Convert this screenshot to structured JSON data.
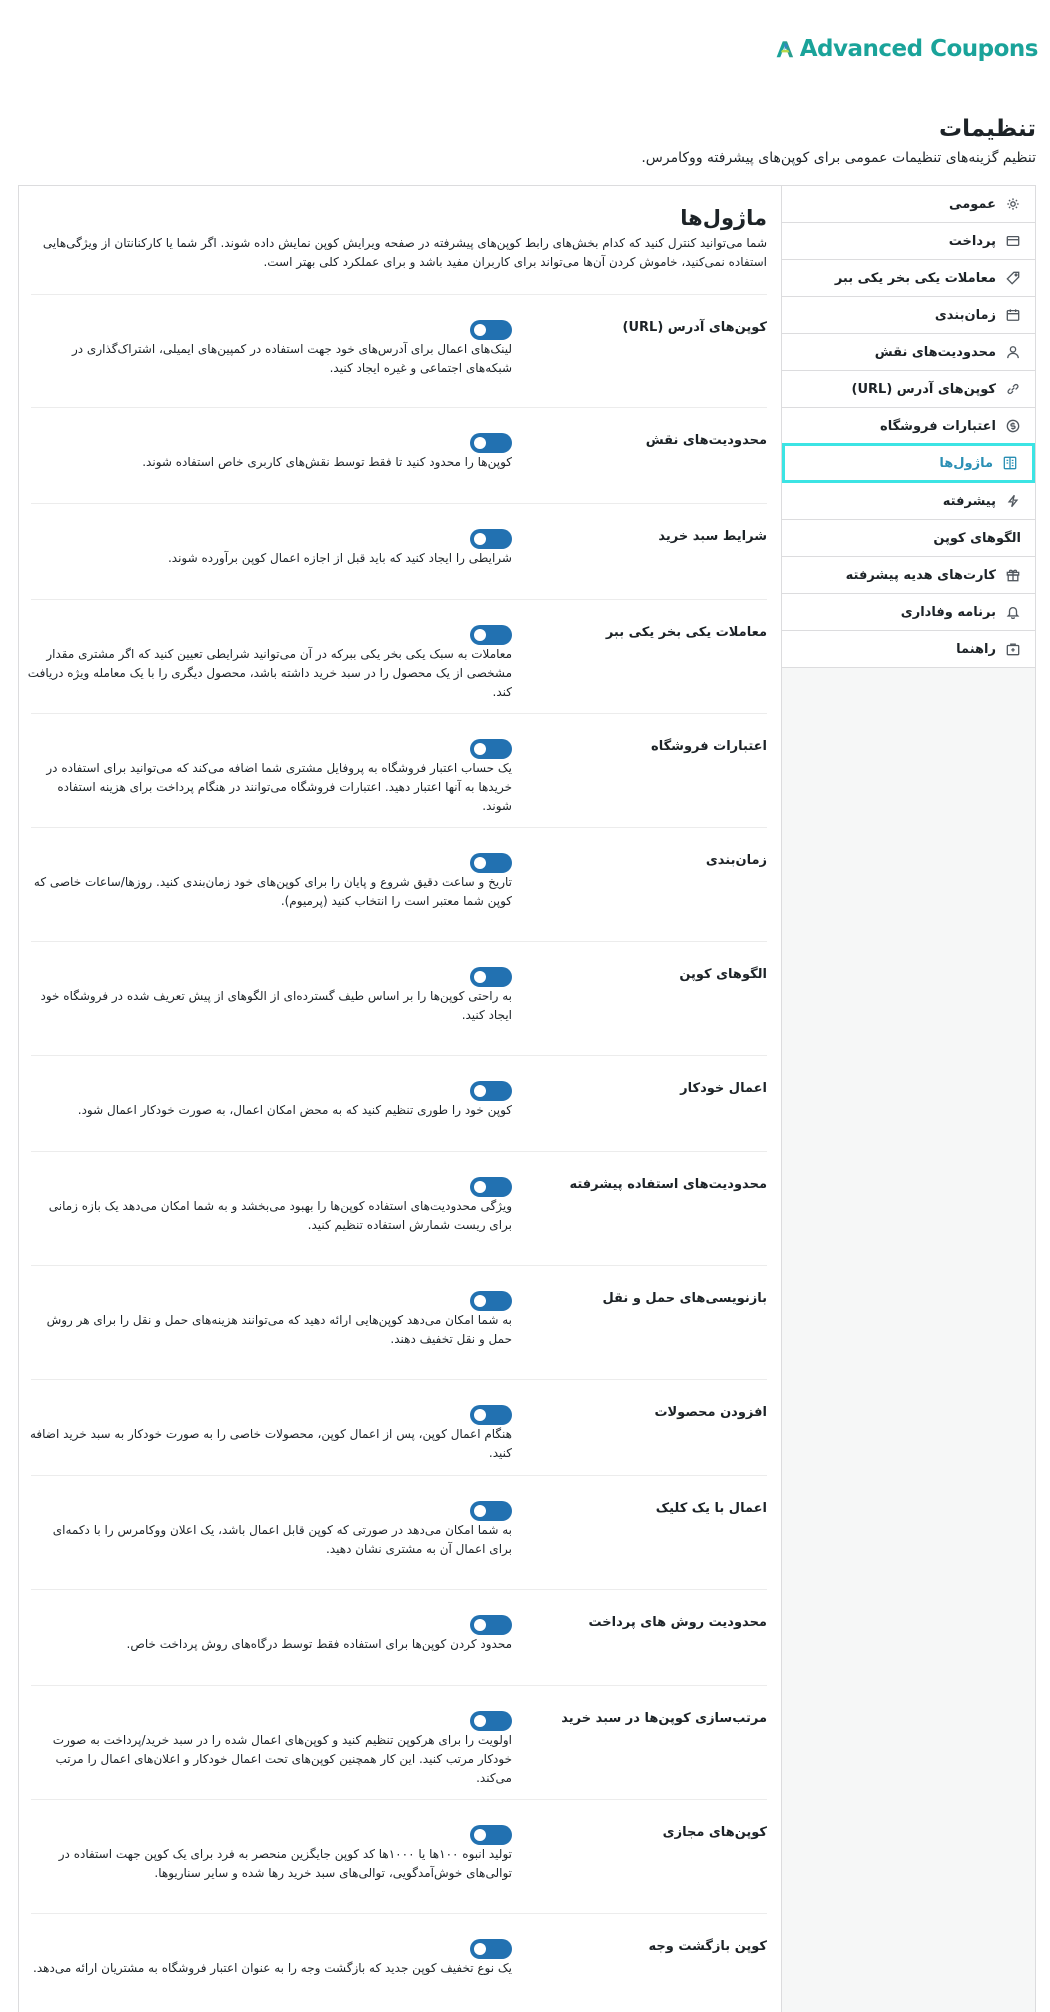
{
  "brand": {
    "name": "Advanced Coupons",
    "color": "#1aa39a"
  },
  "page": {
    "title": "تنظیمات",
    "description": "تنظیم گزینه‌های تنظیمات عمومی برای کوپن‌های پیشرفته ووکامرس."
  },
  "sidebar": {
    "items": [
      {
        "label": "عمومی",
        "icon": "gear-icon"
      },
      {
        "label": "پرداخت",
        "icon": "card-icon"
      },
      {
        "label": "معاملات یکی بخر یکی ببر",
        "icon": "tag-icon"
      },
      {
        "label": "زمان‌بندی",
        "icon": "calendar-icon"
      },
      {
        "label": "محدودیت‌های نقش",
        "icon": "user-icon"
      },
      {
        "label": "کوپن‌های آدرس (URL)",
        "icon": "link-icon"
      },
      {
        "label": "اعتبارات فروشگاه",
        "icon": "dollar-icon"
      },
      {
        "label": "ماژول‌ها",
        "icon": "modules-icon",
        "active": true
      },
      {
        "label": "پیشرفته",
        "icon": "bolt-icon"
      },
      {
        "label": "الگوهای کوپن",
        "icon": ""
      },
      {
        "label": "کارت‌های هدیه پیشرفته",
        "icon": "gift-icon"
      },
      {
        "label": "برنامه وفاداری",
        "icon": "bell-icon"
      },
      {
        "label": "راهنما",
        "icon": "help-icon"
      }
    ],
    "active_color": "#3ce4e4"
  },
  "modules": {
    "title": "ماژول‌ها",
    "description": "شما می‌توانید کنترل کنید که کدام بخش‌های رابط کوپن‌های پیشرفته در صفحه ویرایش کوپن نمایش داده شوند. اگر شما یا کارکنانتان از ویژگی‌هایی استفاده نمی‌کنید، خاموش کردن آن‌ها می‌تواند برای کاربران مفید باشد و برای عملکرد کلی بهتر است.",
    "toggle_color": "#2271b1",
    "rows": [
      {
        "label": "کوپن‌های آدرس (URL)",
        "text": "لینک‌های اعمال برای آدرس‌های خود جهت استفاده در کمپین‌های ایمیلی، اشتراک‌گذاری در شبکه‌های اجتماعی و غیره ایجاد کنید."
      },
      {
        "label": "محدودیت‌های نقش",
        "text": "کوپن‌ها را محدود کنید تا فقط توسط نقش‌های کاربری خاص استفاده شوند."
      },
      {
        "label": "شرایط سبد خرید",
        "text": "شرایطی را ایجاد کنید که باید قبل از اجازه اعمال کوپن برآورده شوند."
      },
      {
        "label": "معاملات یکی بخر یکی ببر",
        "text": "معاملات به سبک یکی بخر یکی ببرکه در آن می‌توانید شرایطی تعیین کنید که اگر مشتری مقدار مشخصی از یک محصول را در سبد خرید داشته باشد، محصول دیگری را با یک معامله ویژه دریافت کند."
      },
      {
        "label": "اعتبارات فروشگاه",
        "text": "یک حساب اعتبار فروشگاه به پروفایل مشتری شما اضافه می‌کند که می‌توانید برای استفاده در خریدها به آنها اعتبار دهید. اعتبارات فروشگاه می‌توانند در هنگام پرداخت برای هزینه استفاده شوند."
      },
      {
        "label": "زمان‌بندی",
        "text": "تاریخ و ساعت دقیق شروع و پایان را برای کوپن‌های خود زمان‌بندی کنید. روزها/ساعات خاصی که کوپن شما معتبر است را انتخاب کنید (پرمیوم)."
      },
      {
        "label": "الگوهای کوپن",
        "text": "به راحتی کوپن‌ها را بر اساس طیف گسترده‌ای از الگوهای از پیش تعریف شده در فروشگاه خود ایجاد کنید."
      },
      {
        "label": "اعمال خودکار",
        "text": "کوپن خود را طوری تنظیم کنید که به محض امکان اعمال، به صورت خودکار اعمال شود."
      },
      {
        "label": "محدودیت‌های استفاده پیشرفته",
        "text": "ویژگی محدودیت‌های استفاده کوپن‌ها را بهبود می‌بخشد و به شما امکان می‌دهد یک بازه زمانی برای ریست شمارش استفاده تنظیم کنید."
      },
      {
        "label": "بازنویسی‌های حمل و نقل",
        "text": "به شما امکان می‌دهد کوپن‌هایی ارائه دهید که می‌توانند هزینه‌های حمل و نقل را برای هر روش حمل و نقل تخفیف دهند."
      },
      {
        "label": "افزودن محصولات",
        "text": "هنگام اعمال کوپن، پس از اعمال کوپن، محصولات خاصی را به صورت خودکار به سبد خرید اضافه کنید."
      },
      {
        "label": "اعمال با یک کلیک",
        "text": "به شما امکان می‌دهد در صورتی که کوپن قابل اعمال باشد، یک اعلان ووکامرس را با دکمه‌ای برای اعمال آن به مشتری نشان دهید."
      },
      {
        "label": "محدودیت روش های پرداخت",
        "text": "محدود کردن کوپن‌ها برای استفاده فقط توسط درگاه‌های روش پرداخت خاص."
      },
      {
        "label": "مرتب‌سازی کوپن‌ها در سبد خرید",
        "text": "اولویت را برای هرکوپن تنظیم کنید و کوپن‌های اعمال شده را در سبد خرید/پرداخت به صورت خودکار مرتب کنید. این کار همچنین کوپن‌های تحت اعمال خودکار و اعلان‌های اعمال را مرتب می‌کند."
      },
      {
        "label": "کوپن‌های مجازی",
        "text": "تولید انبوه ۱۰۰ها یا ۱۰۰۰ها کد کوپن جایگزین منحصر به فرد برای یک کوپن جهت استفاده در توالی‌های خوش‌آمدگویی، توالی‌های سبد خرید رها شده و سایر سناریوها."
      },
      {
        "label": "کوپن بازگشت وجه",
        "text": "یک نوع تخفیف کوپن جدید که بازگشت وجه را به عنوان اعتبار فروشگاه به مشتریان ارائه می‌دهد."
      }
    ]
  }
}
